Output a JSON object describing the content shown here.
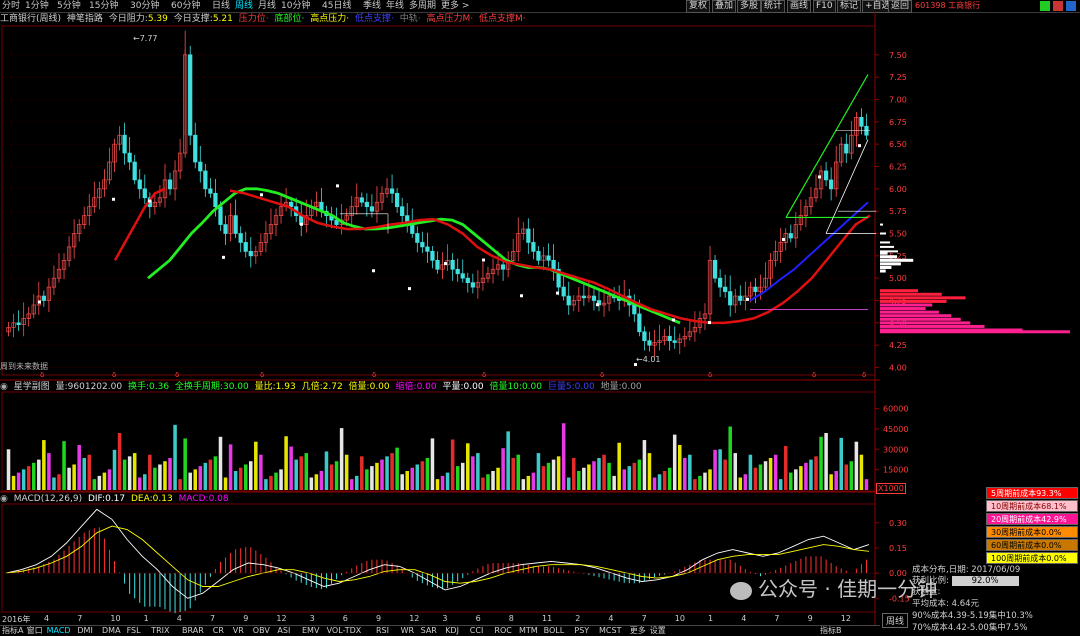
{
  "toolbar": {
    "periods": [
      "分时",
      "1分钟",
      "5分钟",
      "15分钟",
      "30分钟",
      "60分钟",
      "日线",
      "周线",
      "月线",
      "10分钟",
      "45日线",
      "季线",
      "年线",
      "多周期",
      "更多 >"
    ],
    "active_period": "周线",
    "buttons": [
      "复权",
      "叠加",
      "多股",
      "统计",
      "画线",
      "F10",
      "标记",
      "+自选",
      "返回"
    ],
    "stock_code_name": "601398 工商银行"
  },
  "main_info": {
    "stock": "工商银行(周线)",
    "indicator": "神笔指路",
    "resistance_today_label": "今日阻力:",
    "resistance_today": "5.39",
    "support_today_label": "今日支撑:",
    "support_today": "5.21",
    "pressure_label": "压力位·",
    "bottom_label": "底部位·",
    "high_pressure_label": "高点压力·",
    "low_support_label": "低点支撑·",
    "mid_label": "中轨·",
    "high_pressure_m_label": "高点压力M·",
    "low_support_m_label": "低点支撑M·",
    "colors": {
      "white": "#d0d0d0",
      "yellow": "#ffff00",
      "red": "#ff3b3b",
      "cyan": "#00e5ff",
      "green": "#22ff22",
      "blue": "#4040ff",
      "gray": "#808080"
    }
  },
  "annotations": {
    "high": "7.77",
    "low": "4.01",
    "future_label": "周到未来数据"
  },
  "vol_info": {
    "title": "星学副图",
    "vol_label": "量:",
    "vol_value": "9601202.00",
    "turnover_label": "换手:",
    "turnover_value": "0.36",
    "full_turnover_label": "全换手周期:",
    "full_turnover_value": "30.00",
    "ratio_label": "量比:",
    "ratio_value": "1.93",
    "multiple_label": "几倍:",
    "multiple_value": "2.72",
    "double_label": "倍量:",
    "double_value": "0.00",
    "shrink_label": "缩倍:",
    "shrink_value": "0.00",
    "flat_label": "平量:",
    "flat_value": "0.00",
    "double10_label": "倍量10:",
    "double10_value": "0.00",
    "huge_label": "巨量5:",
    "huge_value": "0.00",
    "ground_label": "地量:",
    "ground_value": "0.00",
    "unit": "X1000"
  },
  "macd_info": {
    "title": "MACD(12,26,9)",
    "dif_label": "DIF:",
    "dif_value": "0.17",
    "dea_label": "DEA:",
    "dea_value": "0.13",
    "macd_label": "MACD:",
    "macd_value": "0.08"
  },
  "cost_panel": {
    "rows": [
      {
        "label": "5周期前成本93.3%",
        "bg": "#ff0000",
        "fg": "#ffffff"
      },
      {
        "label": "10周期前成本68.1%",
        "bg": "#ffc0cb",
        "fg": "#800000"
      },
      {
        "label": "20周期前成本42.9%",
        "bg": "#ff1493",
        "fg": "#ffffff"
      },
      {
        "label": "30周期前成本0.0%",
        "bg": "#ff8c00",
        "fg": "#000000"
      },
      {
        "label": "60周期前成本0.0%",
        "bg": "#c87800",
        "fg": "#000000"
      },
      {
        "label": "100周期前成本0.0%",
        "bg": "#ffff00",
        "fg": "#000000"
      }
    ],
    "date_label": "成本分布,日期:",
    "date_value": "2017/06/09",
    "profit_label": "获利比例:",
    "profit_value": "92.0%",
    "profit_disk_label": "获利盘:",
    "avg_cost_label": "平均成本:",
    "avg_cost_value": "4.64元",
    "c90": "90%成本4.39-5.19集中10.3%",
    "c70": "70%成本4.42-5.00集中7.5%",
    "period_label": "周线"
  },
  "bottombar": {
    "tabs": [
      "指标A",
      "窗口",
      "MACD",
      "DMI",
      "DMA",
      "FSL",
      "TRIX",
      "BRAR",
      "CR",
      "VR",
      "OBV",
      "ASI",
      "EMV",
      "VOL-TDX",
      "RSI",
      "WR",
      "SAR",
      "KDJ",
      "CCI",
      "ROC",
      "MTM",
      "BOLL",
      "PSY",
      "MCST",
      "更多",
      "设置"
    ],
    "active": "MACD",
    "right_tab": "指标B"
  },
  "xaxis": {
    "year": "2016年",
    "months": [
      "4",
      "7",
      "10",
      "1",
      "4",
      "7",
      "9",
      "12",
      "3",
      "6",
      "9",
      "12",
      "3",
      "6",
      "8",
      "11",
      "2",
      "4",
      "7",
      "10",
      "1",
      "4",
      "7",
      "9",
      "12"
    ]
  },
  "watermark": "公众号 · 佳期一分钟",
  "chart_data": [
    {
      "type": "candlestick",
      "title": "工商银行(周线)",
      "y_ticks": [
        "7.50",
        "7.25",
        "7.00",
        "6.75",
        "6.50",
        "6.25",
        "6.00",
        "5.75",
        "5.50",
        "5.25",
        "5.00",
        "4.75",
        "4.50",
        "4.25",
        "4.00"
      ],
      "ylim": [
        3.95,
        7.8
      ],
      "high": 7.77,
      "low": 4.01,
      "close_series": [
        4.45,
        4.5,
        4.48,
        4.55,
        4.6,
        4.7,
        4.8,
        4.75,
        4.9,
        5.0,
        5.1,
        5.2,
        5.35,
        5.5,
        5.6,
        5.7,
        5.8,
        5.9,
        6.0,
        6.1,
        6.3,
        6.5,
        6.6,
        6.4,
        6.3,
        6.1,
        6.0,
        5.9,
        5.8,
        5.85,
        5.9,
        6.1,
        6.0,
        6.2,
        6.4,
        7.5,
        6.6,
        6.3,
        6.2,
        6.0,
        5.95,
        5.8,
        5.6,
        5.5,
        5.7,
        5.5,
        5.4,
        5.3,
        5.25,
        5.3,
        5.4,
        5.5,
        5.6,
        5.7,
        5.8,
        5.85,
        5.8,
        5.7,
        5.6,
        5.7,
        5.8,
        5.85,
        5.75,
        5.7,
        5.65,
        5.6,
        5.65,
        5.7,
        5.8,
        5.9,
        5.85,
        5.8,
        5.75,
        5.85,
        5.95,
        6.0,
        5.95,
        5.8,
        5.7,
        5.6,
        5.5,
        5.4,
        5.35,
        5.3,
        5.2,
        5.1,
        5.15,
        5.2,
        5.1,
        5.05,
        5.0,
        4.95,
        4.9,
        4.95,
        5.0,
        5.05,
        5.1,
        5.15,
        5.1,
        5.2,
        5.3,
        5.5,
        5.55,
        5.4,
        5.3,
        5.2,
        5.25,
        5.2,
        5.1,
        4.9,
        4.8,
        4.7,
        4.75,
        4.8,
        4.78,
        4.8,
        4.75,
        4.7,
        4.72,
        4.8,
        4.78,
        4.75,
        4.8,
        4.7,
        4.6,
        4.4,
        4.3,
        4.25,
        4.28,
        4.3,
        4.35,
        4.3,
        4.28,
        4.32,
        4.35,
        4.4,
        4.45,
        4.55,
        4.6,
        5.2,
        5.0,
        4.9,
        4.85,
        4.7,
        4.8,
        4.75,
        4.8,
        4.9,
        4.85,
        4.9,
        5.0,
        5.2,
        5.3,
        5.4,
        5.5,
        5.45,
        5.6,
        5.7,
        5.8,
        5.9,
        6.0,
        6.2,
        6.1,
        6.0,
        6.3,
        6.5,
        6.4,
        6.6,
        6.8,
        6.7,
        6.6
      ],
      "ma_green": [
        5.0,
        5.1,
        5.2,
        5.35,
        5.5,
        5.62,
        5.75,
        5.85,
        5.95,
        6.0,
        6.0,
        5.98,
        5.95,
        5.9,
        5.85,
        5.8,
        5.75,
        5.7,
        5.62,
        5.58,
        5.55,
        5.55,
        5.56,
        5.58,
        5.6,
        5.62,
        5.64,
        5.66,
        5.65,
        5.6,
        5.5,
        5.4,
        5.3,
        5.2,
        5.15,
        5.12,
        5.12,
        5.1,
        5.05,
        5.0,
        4.95,
        4.9,
        4.85,
        4.8,
        4.75,
        4.7,
        4.65,
        4.6,
        4.55,
        4.5
      ],
      "ma_red": [
        5.2,
        5.4,
        5.6,
        5.8,
        5.95,
        6.0,
        5.98,
        5.95,
        5.9,
        5.85,
        5.8,
        5.7,
        5.62,
        5.58,
        5.55,
        5.55,
        5.57,
        5.6,
        5.62,
        5.65,
        5.66,
        5.6,
        5.5,
        5.35,
        5.25,
        5.18,
        5.15,
        5.12,
        5.1,
        5.05,
        5.0,
        4.95,
        4.88,
        4.8,
        4.72,
        4.65,
        4.6,
        4.55,
        4.52,
        4.5,
        4.5,
        4.52,
        4.55,
        4.62,
        4.72,
        4.85,
        5.0,
        5.2,
        5.4,
        5.6,
        5.7
      ],
      "ma_blue": [
        4.75,
        4.85,
        4.98,
        5.1,
        5.25,
        5.4,
        5.55,
        5.7,
        5.85
      ],
      "h_lines": [
        5.75,
        5.72,
        5.5,
        4.65,
        6.65
      ]
    },
    {
      "type": "bar",
      "title": "星学副图",
      "y_ticks": [
        "60000",
        "45000",
        "30000",
        "15000"
      ],
      "ylim": [
        0,
        70000
      ]
    },
    {
      "type": "line",
      "title": "MACD(12,26,9)",
      "y_ticks": [
        "0.30",
        "0.15",
        "0.00",
        "-0.15"
      ],
      "ylim": [
        -0.22,
        0.4
      ],
      "series": [
        {
          "name": "DIF",
          "values": [
            0.0,
            0.02,
            0.05,
            0.1,
            0.18,
            0.28,
            0.38,
            0.32,
            0.2,
            0.1,
            0.02,
            -0.08,
            -0.15,
            -0.12,
            -0.05,
            0.02,
            0.06,
            0.05,
            0.03,
            0.0,
            -0.04,
            -0.08,
            -0.06,
            -0.02,
            0.02,
            0.05,
            0.04,
            0.0,
            -0.05,
            -0.1,
            -0.08,
            -0.04,
            0.0,
            0.03,
            0.05,
            0.06,
            0.07,
            0.06,
            0.05,
            0.03,
            0.0,
            -0.03,
            -0.05,
            -0.04,
            -0.02,
            0.02,
            0.08,
            0.12,
            0.14,
            0.12,
            0.1,
            0.12,
            0.16,
            0.2,
            0.22,
            0.18,
            0.14,
            0.17
          ]
        },
        {
          "name": "DEA",
          "values": [
            0.0,
            0.01,
            0.03,
            0.06,
            0.1,
            0.16,
            0.24,
            0.28,
            0.26,
            0.2,
            0.12,
            0.04,
            -0.04,
            -0.08,
            -0.08,
            -0.05,
            -0.02,
            0.0,
            0.02,
            0.02,
            0.0,
            -0.03,
            -0.05,
            -0.04,
            -0.02,
            0.01,
            0.02,
            0.02,
            -0.01,
            -0.05,
            -0.06,
            -0.05,
            -0.03,
            0.0,
            0.02,
            0.04,
            0.05,
            0.05,
            0.05,
            0.04,
            0.02,
            0.0,
            -0.02,
            -0.03,
            -0.02,
            0.0,
            0.04,
            0.08,
            0.1,
            0.11,
            0.11,
            0.11,
            0.13,
            0.15,
            0.17,
            0.16,
            0.14,
            0.13
          ]
        }
      ]
    }
  ]
}
